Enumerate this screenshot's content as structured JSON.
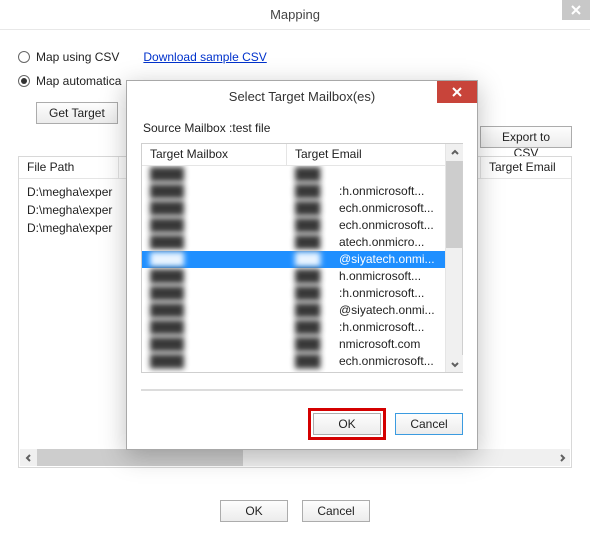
{
  "parent": {
    "title": "Mapping",
    "radio_csv_label": "Map using CSV",
    "download_link": "Download sample CSV",
    "radio_auto_label": "Map automatica",
    "get_target_label": "Get Target",
    "export_label": "Export to CSV",
    "ok_label": "OK",
    "cancel_label": "Cancel",
    "columns": {
      "file_path": "File Path",
      "target_email": "Target Email"
    },
    "rows": [
      "D:\\megha\\exper",
      "D:\\megha\\exper",
      "D:\\megha\\exper"
    ]
  },
  "modal": {
    "title": "Select Target Mailbox(es)",
    "source_label": "Source Mailbox :test file",
    "columns": {
      "target_mailbox": "Target Mailbox",
      "target_email": "Target Email"
    },
    "ok_label": "OK",
    "cancel_label": "Cancel",
    "selected_index": 5,
    "rows": [
      {
        "mailbox": "",
        "email": ""
      },
      {
        "mailbox": "",
        "email": ":h.onmicrosoft..."
      },
      {
        "mailbox": "",
        "email": "ech.onmicrosoft..."
      },
      {
        "mailbox": "",
        "email": "ech.onmicrosoft..."
      },
      {
        "mailbox": "",
        "email": "atech.onmicro..."
      },
      {
        "mailbox": "",
        "email": "@siyatech.onmi..."
      },
      {
        "mailbox": "",
        "email": "h.onmicrosoft..."
      },
      {
        "mailbox": "",
        "email": ":h.onmicrosoft..."
      },
      {
        "mailbox": "",
        "email": "@siyatech.onmi..."
      },
      {
        "mailbox": "",
        "email": ":h.onmicrosoft..."
      },
      {
        "mailbox": "",
        "email": "nmicrosoft.com"
      },
      {
        "mailbox": "",
        "email": "ech.onmicrosoft..."
      }
    ]
  }
}
